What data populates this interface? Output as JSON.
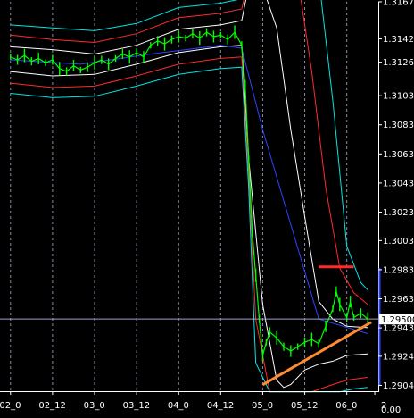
{
  "chart_data": {
    "type": "line",
    "title": "",
    "xlabel": "",
    "ylabel": "",
    "ylim": [
      1.29004,
      1.31679
    ],
    "x_ticks": [
      "02_0",
      "02_12",
      "03_0",
      "03_12",
      "04_0",
      "04_12",
      "05_0",
      "05_12",
      "06_0",
      "2"
    ],
    "x_tick_values": [
      0,
      12,
      24,
      36,
      48,
      60,
      72,
      84,
      96,
      104
    ],
    "x_extra_label": "0.00",
    "y_ticks": [
      "1.31679",
      "1.31424",
      "1.31264",
      "1.31034",
      "1.30834",
      "1.30634",
      "1.30434",
      "1.30234",
      "1.30039",
      "1.29839",
      "1.29639",
      "1.29439",
      "1.29244",
      "1.29044"
    ],
    "y_tick_values": [
      1.31679,
      1.31424,
      1.31264,
      1.31034,
      1.30834,
      1.30634,
      1.30434,
      1.30234,
      1.30039,
      1.29839,
      1.29639,
      1.29439,
      1.29244,
      1.29044
    ],
    "current_price": "1.29500",
    "current_price_value": 1.295,
    "series": [
      {
        "values": [
          [
            0,
            1.313
          ],
          [
            2,
            1.3128
          ],
          [
            4,
            1.3131
          ],
          [
            6,
            1.3127
          ],
          [
            8,
            1.3129
          ],
          [
            10,
            1.3126
          ],
          [
            12,
            1.3128
          ],
          [
            14,
            1.3122
          ],
          [
            16,
            1.312
          ],
          [
            18,
            1.3124
          ],
          [
            20,
            1.3121
          ],
          [
            22,
            1.3123
          ],
          [
            24,
            1.3126
          ],
          [
            26,
            1.3128
          ],
          [
            28,
            1.3125
          ],
          [
            30,
            1.3129
          ],
          [
            32,
            1.3132
          ],
          [
            34,
            1.313
          ],
          [
            36,
            1.3133
          ],
          [
            38,
            1.313
          ],
          [
            40,
            1.3138
          ],
          [
            42,
            1.3141
          ],
          [
            44,
            1.3139
          ],
          [
            46,
            1.3142
          ],
          [
            48,
            1.3144
          ],
          [
            50,
            1.3143
          ],
          [
            52,
            1.3146
          ],
          [
            54,
            1.3143
          ],
          [
            56,
            1.3147
          ],
          [
            58,
            1.3144
          ],
          [
            60,
            1.3145
          ],
          [
            62,
            1.3142
          ],
          [
            64,
            1.3147
          ],
          [
            66,
            1.3138
          ],
          [
            67,
            1.311
          ],
          [
            68,
            1.306
          ],
          [
            69,
            1.301
          ],
          [
            70,
            1.298
          ],
          [
            71,
            1.295
          ],
          [
            72,
            1.2925
          ],
          [
            73,
            1.2934
          ],
          [
            74,
            1.2941
          ],
          [
            76,
            1.2937
          ],
          [
            78,
            1.2931
          ],
          [
            80,
            1.2928
          ],
          [
            82,
            1.2931
          ],
          [
            84,
            1.2934
          ],
          [
            86,
            1.2936
          ],
          [
            88,
            1.2933
          ],
          [
            90,
            1.2945
          ],
          [
            92,
            1.2957
          ],
          [
            93,
            1.2969
          ],
          [
            94,
            1.296
          ],
          [
            96,
            1.2951
          ],
          [
            97,
            1.2962
          ],
          [
            98,
            1.2951
          ],
          [
            100,
            1.2954
          ],
          [
            102,
            1.295
          ]
        ],
        "color": "#00ff00"
      },
      {
        "values": [
          [
            0,
            1.3128
          ],
          [
            20,
            1.3125
          ],
          [
            40,
            1.3132
          ],
          [
            60,
            1.3138
          ],
          [
            66,
            1.3136
          ],
          [
            72,
            1.308
          ],
          [
            88,
            1.295
          ],
          [
            102,
            1.294
          ]
        ],
        "color": "#2e43ff"
      }
    ],
    "bands": [
      {
        "color": "#ffffff",
        "upper": [
          [
            0,
            1.3137
          ],
          [
            12,
            1.3135
          ],
          [
            24,
            1.3132
          ],
          [
            36,
            1.3138
          ],
          [
            48,
            1.3149
          ],
          [
            60,
            1.3152
          ],
          [
            66,
            1.3155
          ],
          [
            68,
            1.3179
          ],
          [
            72,
            1.3178
          ],
          [
            76,
            1.315
          ],
          [
            80,
            1.308
          ],
          [
            84,
            1.302
          ],
          [
            88,
            1.2962
          ],
          [
            92,
            1.295
          ],
          [
            96,
            1.2945
          ],
          [
            102,
            1.2944
          ]
        ],
        "lower": [
          [
            0,
            1.312
          ],
          [
            12,
            1.3117
          ],
          [
            24,
            1.3118
          ],
          [
            36,
            1.3125
          ],
          [
            48,
            1.3133
          ],
          [
            60,
            1.3137
          ],
          [
            66,
            1.3138
          ],
          [
            68,
            1.306
          ],
          [
            72,
            1.296
          ],
          [
            76,
            1.2908
          ],
          [
            78,
            1.2903
          ],
          [
            80,
            1.2905
          ],
          [
            84,
            1.2915
          ],
          [
            88,
            1.2919
          ],
          [
            92,
            1.2921
          ],
          [
            96,
            1.2925
          ],
          [
            102,
            1.2926
          ]
        ]
      },
      {
        "color": "#ff2a2a",
        "upper": [
          [
            0,
            1.3145
          ],
          [
            12,
            1.3142
          ],
          [
            24,
            1.314
          ],
          [
            36,
            1.3146
          ],
          [
            48,
            1.3157
          ],
          [
            60,
            1.316
          ],
          [
            66,
            1.3163
          ],
          [
            68,
            1.3184
          ],
          [
            72,
            1.3184
          ],
          [
            76,
            1.3184
          ],
          [
            82,
            1.3184
          ],
          [
            86,
            1.312
          ],
          [
            90,
            1.304
          ],
          [
            94,
            1.2985
          ],
          [
            98,
            1.2968
          ],
          [
            102,
            1.296
          ]
        ],
        "lower": [
          [
            0,
            1.3112
          ],
          [
            12,
            1.3109
          ],
          [
            24,
            1.311
          ],
          [
            36,
            1.3117
          ],
          [
            48,
            1.3125
          ],
          [
            60,
            1.3129
          ],
          [
            66,
            1.313
          ],
          [
            68,
            1.305
          ],
          [
            70,
            1.295
          ],
          [
            74,
            1.29
          ],
          [
            82,
            1.29
          ],
          [
            86,
            1.29
          ],
          [
            92,
            1.2905
          ],
          [
            96,
            1.2908
          ],
          [
            102,
            1.291
          ]
        ]
      },
      {
        "color": "#00e5e5",
        "upper": [
          [
            0,
            1.3152
          ],
          [
            12,
            1.315
          ],
          [
            24,
            1.3148
          ],
          [
            36,
            1.3153
          ],
          [
            48,
            1.3164
          ],
          [
            60,
            1.3167
          ],
          [
            66,
            1.317
          ],
          [
            68,
            1.3184
          ],
          [
            74,
            1.3184
          ],
          [
            88,
            1.3184
          ],
          [
            92,
            1.31
          ],
          [
            96,
            1.3
          ],
          [
            100,
            1.2975
          ],
          [
            102,
            1.297
          ]
        ],
        "lower": [
          [
            0,
            1.3105
          ],
          [
            12,
            1.3102
          ],
          [
            24,
            1.3103
          ],
          [
            36,
            1.311
          ],
          [
            48,
            1.3118
          ],
          [
            60,
            1.3122
          ],
          [
            66,
            1.3123
          ],
          [
            68,
            1.304
          ],
          [
            70,
            1.292
          ],
          [
            74,
            1.29
          ],
          [
            90,
            1.29
          ],
          [
            94,
            1.29
          ],
          [
            98,
            1.2902
          ],
          [
            102,
            1.2903
          ]
        ]
      }
    ],
    "annotations": [
      {
        "type": "hline",
        "color": "#ff2a2a",
        "x": [
          88,
          98
        ],
        "y": 1.29858
      },
      {
        "type": "trendline",
        "color": "#ff8c33",
        "x": [
          72,
          103
        ],
        "y": [
          1.29048,
          1.29478
        ]
      }
    ],
    "grid": true
  }
}
